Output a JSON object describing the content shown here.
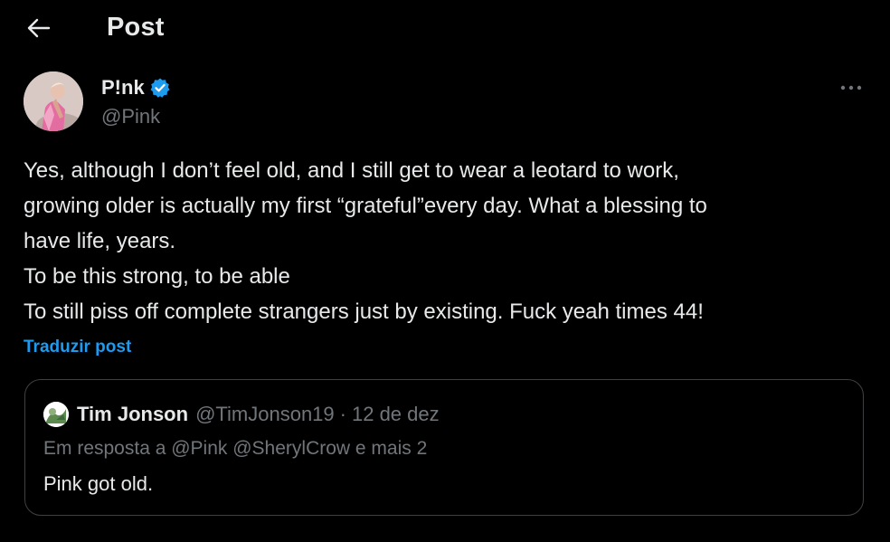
{
  "header": {
    "title": "Post",
    "back_icon": "arrow-left-icon"
  },
  "post": {
    "author_name": "P!nk",
    "author_handle": "@Pink",
    "verified_icon": "verified-badge-icon",
    "more_icon": "more-horizontal-icon",
    "text_lines": [
      "Yes, although I don’t feel old, and I still get to wear a leotard to work,",
      "growing older is actually my first “grateful”every day. What a blessing to",
      "have life, years.",
      "To be this strong, to be able",
      "To still piss off complete strangers just by existing. Fuck yeah times 44!"
    ],
    "translate_label": "Traduzir post"
  },
  "quote": {
    "author_name": "Tim Jonson",
    "author_handle": "@TimJonson19",
    "separator": "·",
    "date": "12 de dez",
    "reply_context": "Em resposta a @Pink @SherylCrow e mais 2",
    "text": "Pink got old."
  },
  "colors": {
    "background": "#000000",
    "text_primary": "#e7e9ea",
    "text_secondary": "#71767b",
    "accent": "#1d9bf0",
    "border": "#3e4144"
  }
}
